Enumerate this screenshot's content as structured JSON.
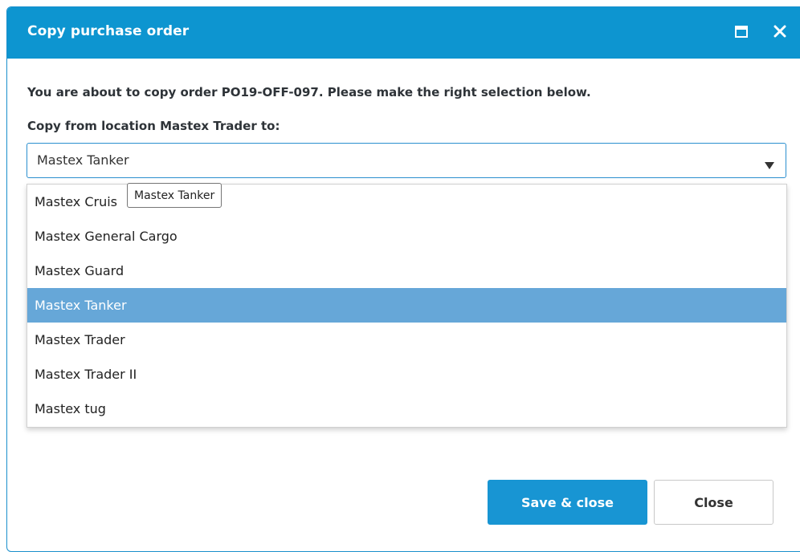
{
  "dialog": {
    "title": "Copy purchase order",
    "intro": "You are about to copy order PO19-OFF-097. Please make the right selection below.",
    "copy_label": "Copy from location Mastex Trader to:",
    "select": {
      "value": "Mastex Tanker",
      "options": [
        "Mastex Cruis",
        "Mastex General Cargo",
        "Mastex Guard",
        "Mastex Tanker",
        "Mastex Trader",
        "Mastex Trader II",
        "Mastex tug"
      ],
      "selected_index": 3
    },
    "tooltip": "Mastex Tanker",
    "buttons": {
      "save_close": "Save & close",
      "close": "Close"
    }
  },
  "colors": {
    "header": "#0d95d0",
    "selected_option": "#66a7d8",
    "primary_button": "#1895d3"
  },
  "icons": {
    "maximize": "window-maximize-icon",
    "close": "close-icon",
    "dropdown": "caret-down-icon"
  }
}
